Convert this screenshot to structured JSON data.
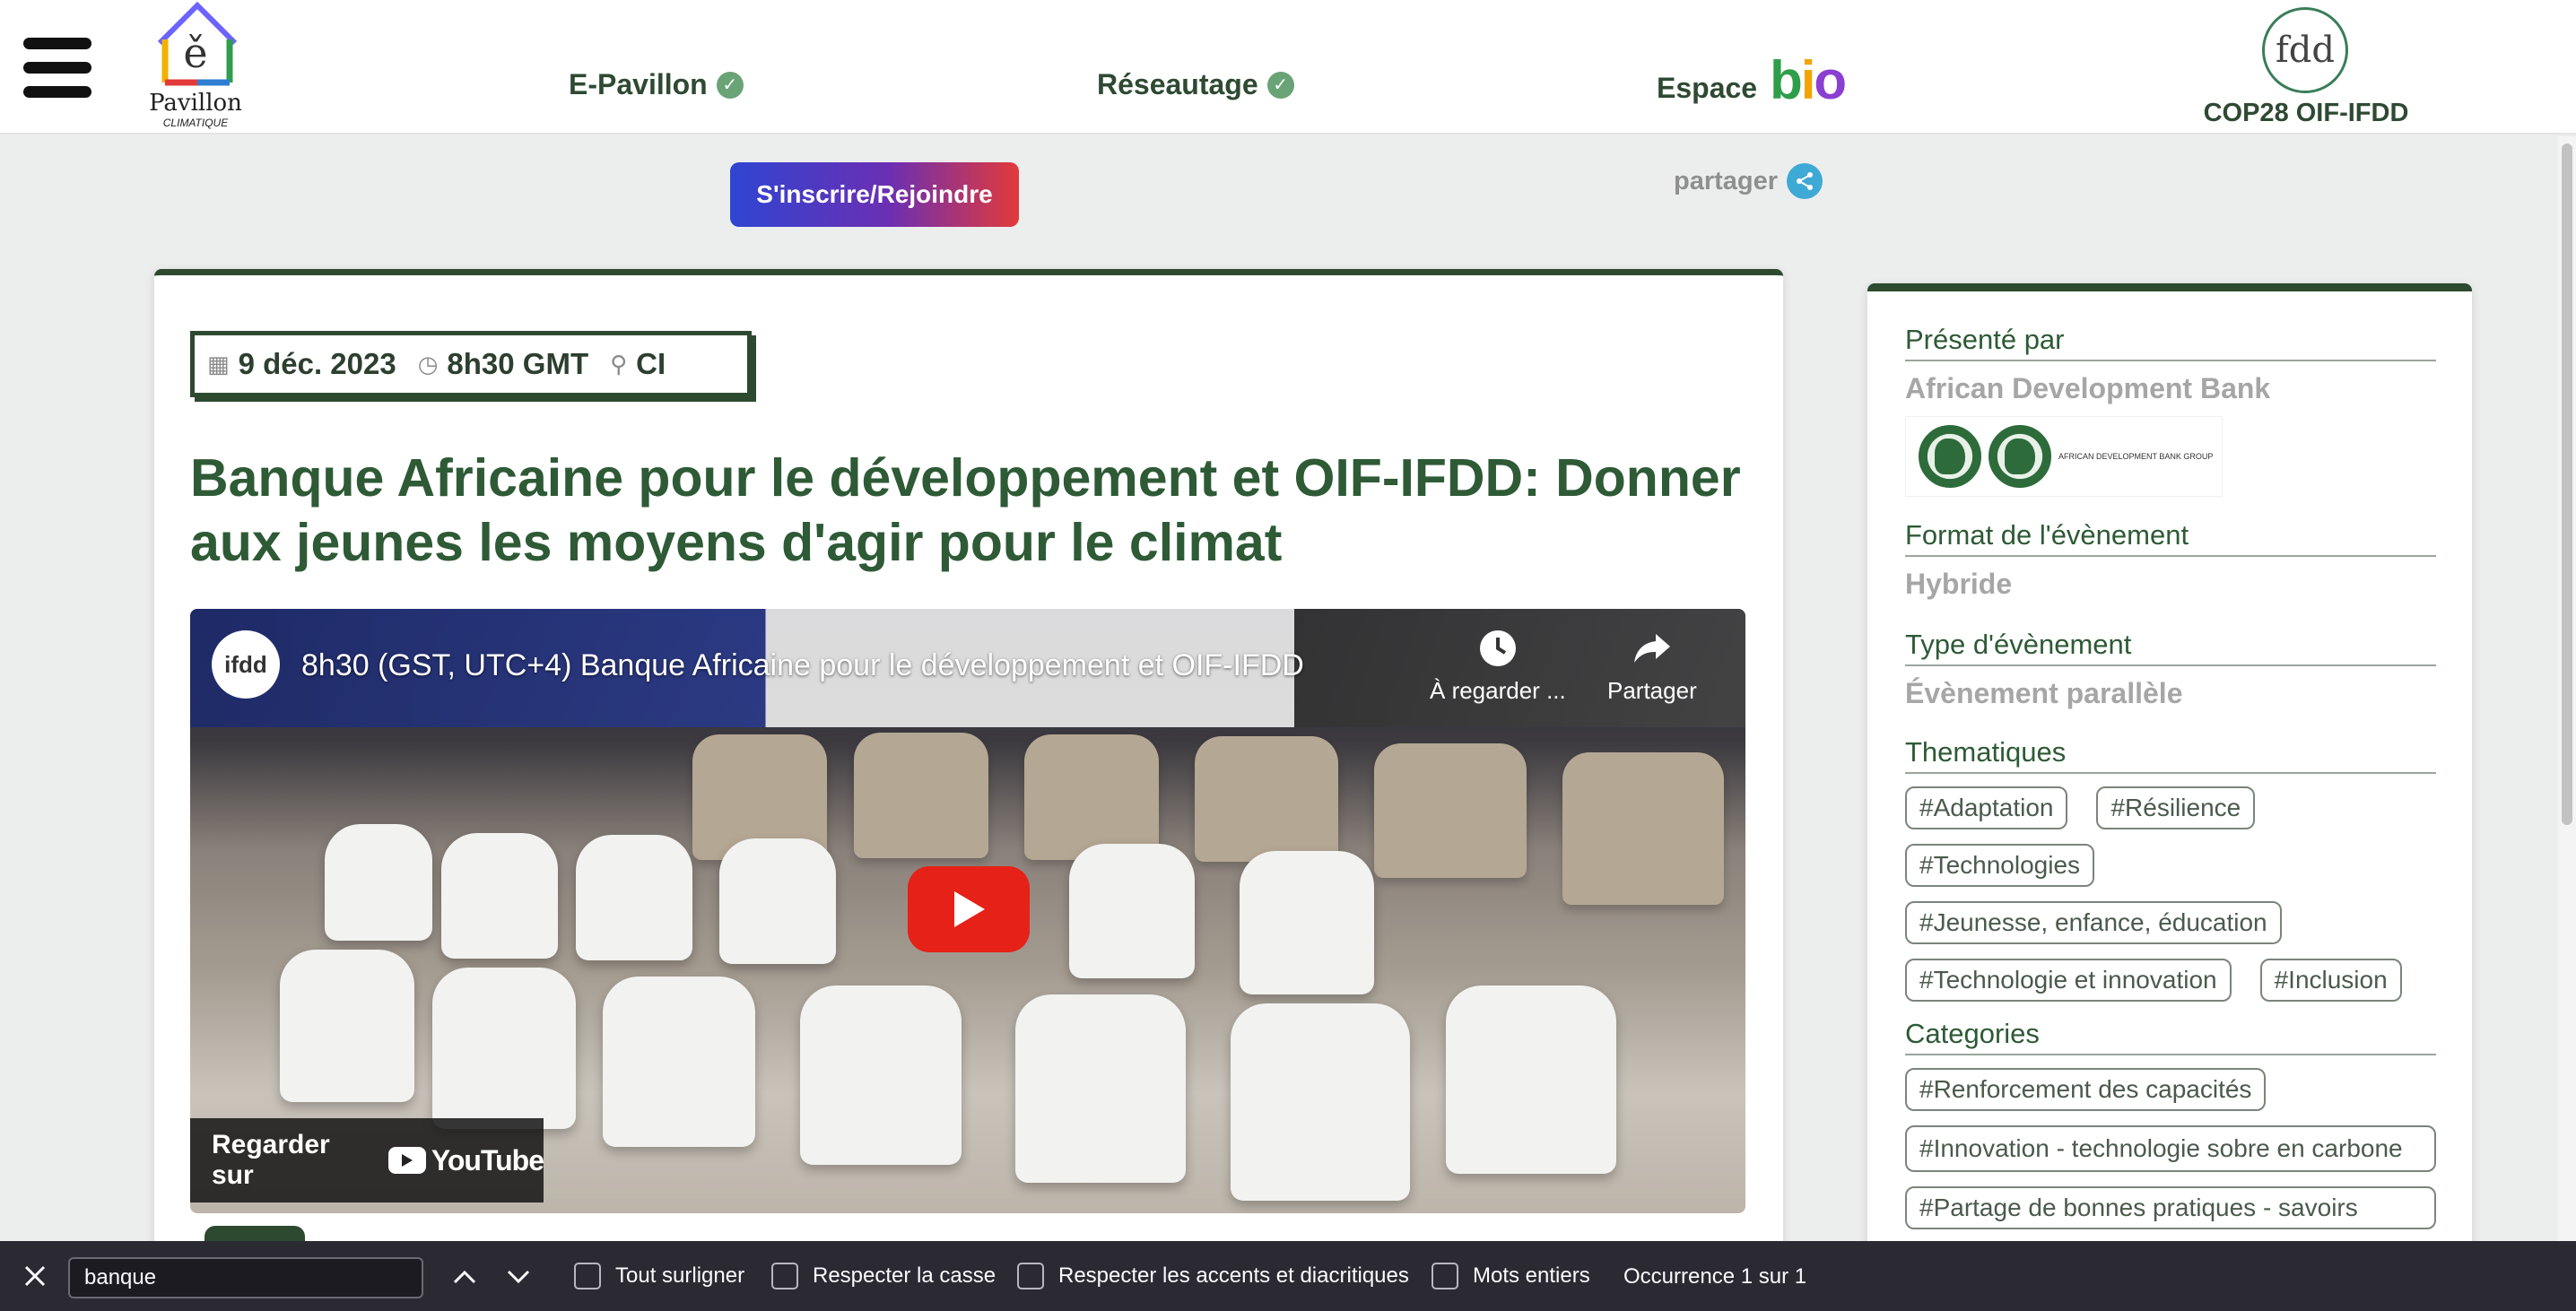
{
  "header": {
    "logo": {
      "mark": "ě",
      "name": "Pavillon",
      "sub": "CLIMATIQUE"
    },
    "nav": [
      {
        "label": "E-Pavillon"
      },
      {
        "label": "Réseautage"
      },
      {
        "label": "Espace",
        "accent": "bio"
      }
    ],
    "cop": {
      "mark": "fdd",
      "label": "COP28 OIF-IFDD"
    }
  },
  "actions": {
    "join_label": "S'inscrire/Rejoindre",
    "share_label": "partager"
  },
  "event": {
    "date": "9 déc. 2023",
    "time": "8h30 GMT",
    "location": "CI",
    "title": "Banque Africaine pour le développement et OIF-IFDD: Donner aux jeunes les moyens d'agir pour le climat"
  },
  "video": {
    "channel_avatar": "ifdd",
    "title": "8h30 (GST, UTC+4) Banque Africaine pour le développement et OIF-IFDD",
    "watch_later_label": "À regarder ...",
    "share_label": "Partager",
    "watch_on_label": "Regarder sur",
    "youtube_label": "YouTube"
  },
  "sidebar": {
    "presented_by_label": "Présenté par",
    "presenter": "African Development Bank",
    "presenter_logo_text": "AFRICAN DEVELOPMENT BANK GROUP",
    "format_label": "Format de l'évènement",
    "format_value": "Hybride",
    "type_label": "Type d'évènement",
    "type_value": "Évènement parallèle",
    "themes_label": "Thematiques",
    "themes": [
      "#Adaptation",
      "#Résilience",
      "#Technologies",
      "#Jeunesse, enfance, éducation",
      "#Technologie et innovation",
      "#Inclusion"
    ],
    "categories_label": "Categories",
    "categories": [
      "#Renforcement des capacités",
      "#Innovation - technologie sobre en carbone",
      "#Partage de bonnes pratiques - savoirs"
    ]
  },
  "findbar": {
    "query": "banque",
    "options": [
      "Tout surligner",
      "Respecter la casse",
      "Respecter les accents et diacritiques",
      "Mots entiers"
    ],
    "match_count": "Occurrence 1 sur 1"
  },
  "colors": {
    "brand_green": "#2d4a30",
    "title_green": "#2e5a36",
    "check_green": "#6aa376",
    "share_blue": "#3fa9d6",
    "youtube_red": "#e62117",
    "findbar_bg": "#2b2a33"
  }
}
